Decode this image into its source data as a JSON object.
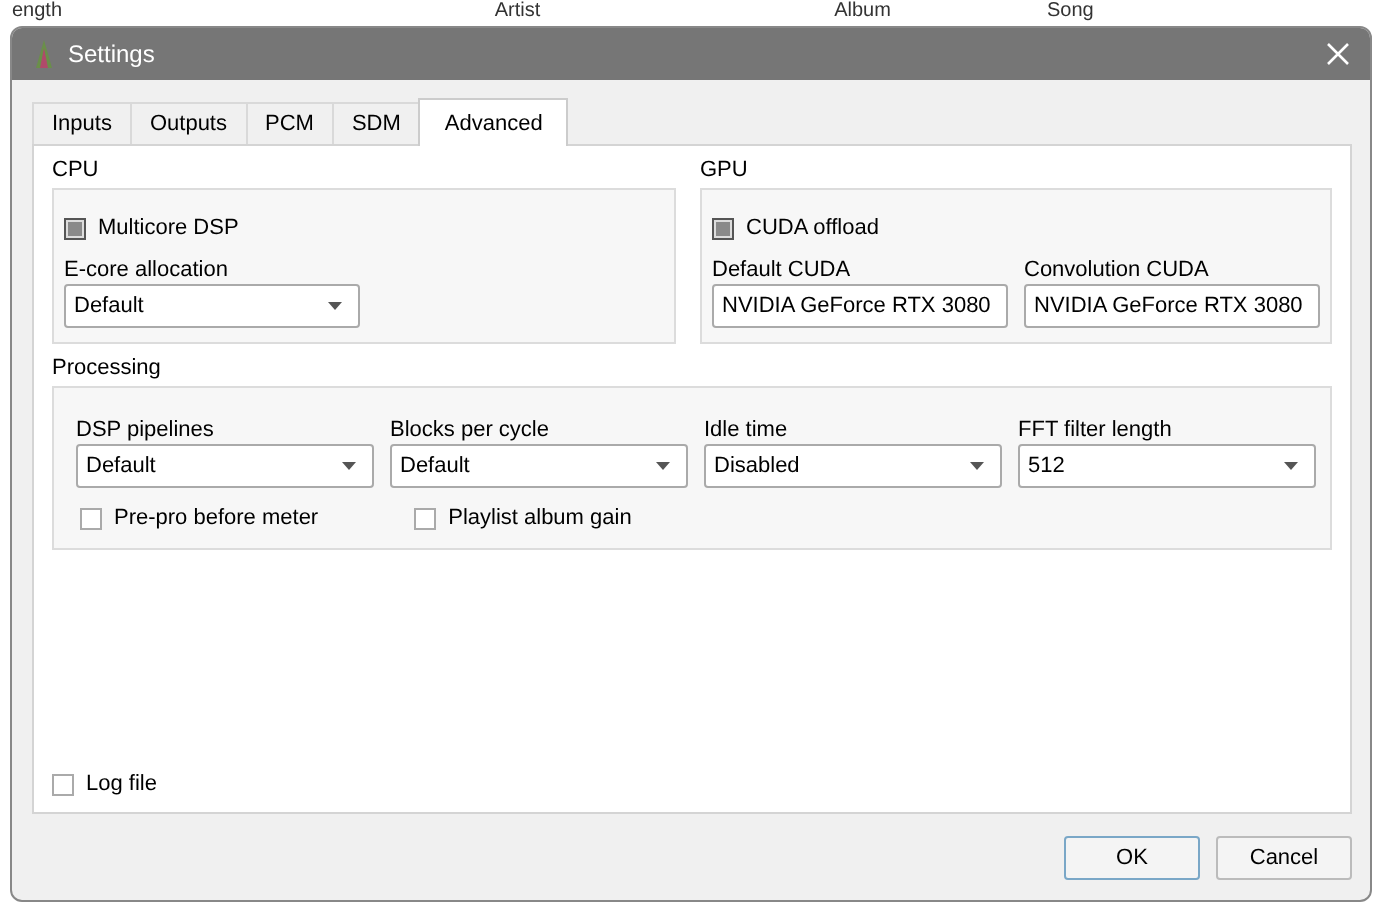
{
  "background_table": {
    "columns": [
      "ength",
      "Artist",
      "Album",
      "Song"
    ]
  },
  "window": {
    "title": "Settings"
  },
  "tabs": [
    {
      "label": "Inputs",
      "selected": false
    },
    {
      "label": "Outputs",
      "selected": false
    },
    {
      "label": "PCM",
      "selected": false
    },
    {
      "label": "SDM",
      "selected": false
    },
    {
      "label": "Advanced",
      "selected": true
    }
  ],
  "cpu": {
    "title": "CPU",
    "checkbox": {
      "label": "Multicore DSP",
      "checked": true
    },
    "dropdowns": [
      {
        "label": "E-core allocation",
        "value": "Default"
      }
    ]
  },
  "gpu": {
    "title": "GPU",
    "checkbox": {
      "label": "CUDA offload",
      "checked": true
    },
    "dropdowns": [
      {
        "label": "Default CUDA",
        "value": "NVIDIA GeForce RTX 3080"
      },
      {
        "label": "Convolution CUDA",
        "value": "NVIDIA GeForce RTX 3080"
      }
    ]
  },
  "processing": {
    "title": "Processing",
    "dropdowns": [
      {
        "label": "DSP pipelines",
        "value": "Default"
      },
      {
        "label": "Blocks per cycle",
        "value": "Default"
      },
      {
        "label": "Idle time",
        "value": "Disabled"
      },
      {
        "label": "FFT filter length",
        "value": "512"
      }
    ],
    "checkboxes": [
      {
        "label": "Pre-pro before meter",
        "checked": false
      },
      {
        "label": "Playlist album gain",
        "checked": false
      }
    ]
  },
  "log_file": {
    "label": "Log file",
    "checked": false
  },
  "buttons": [
    {
      "label": "OK",
      "default": true
    },
    {
      "label": "Cancel",
      "default": false
    }
  ]
}
